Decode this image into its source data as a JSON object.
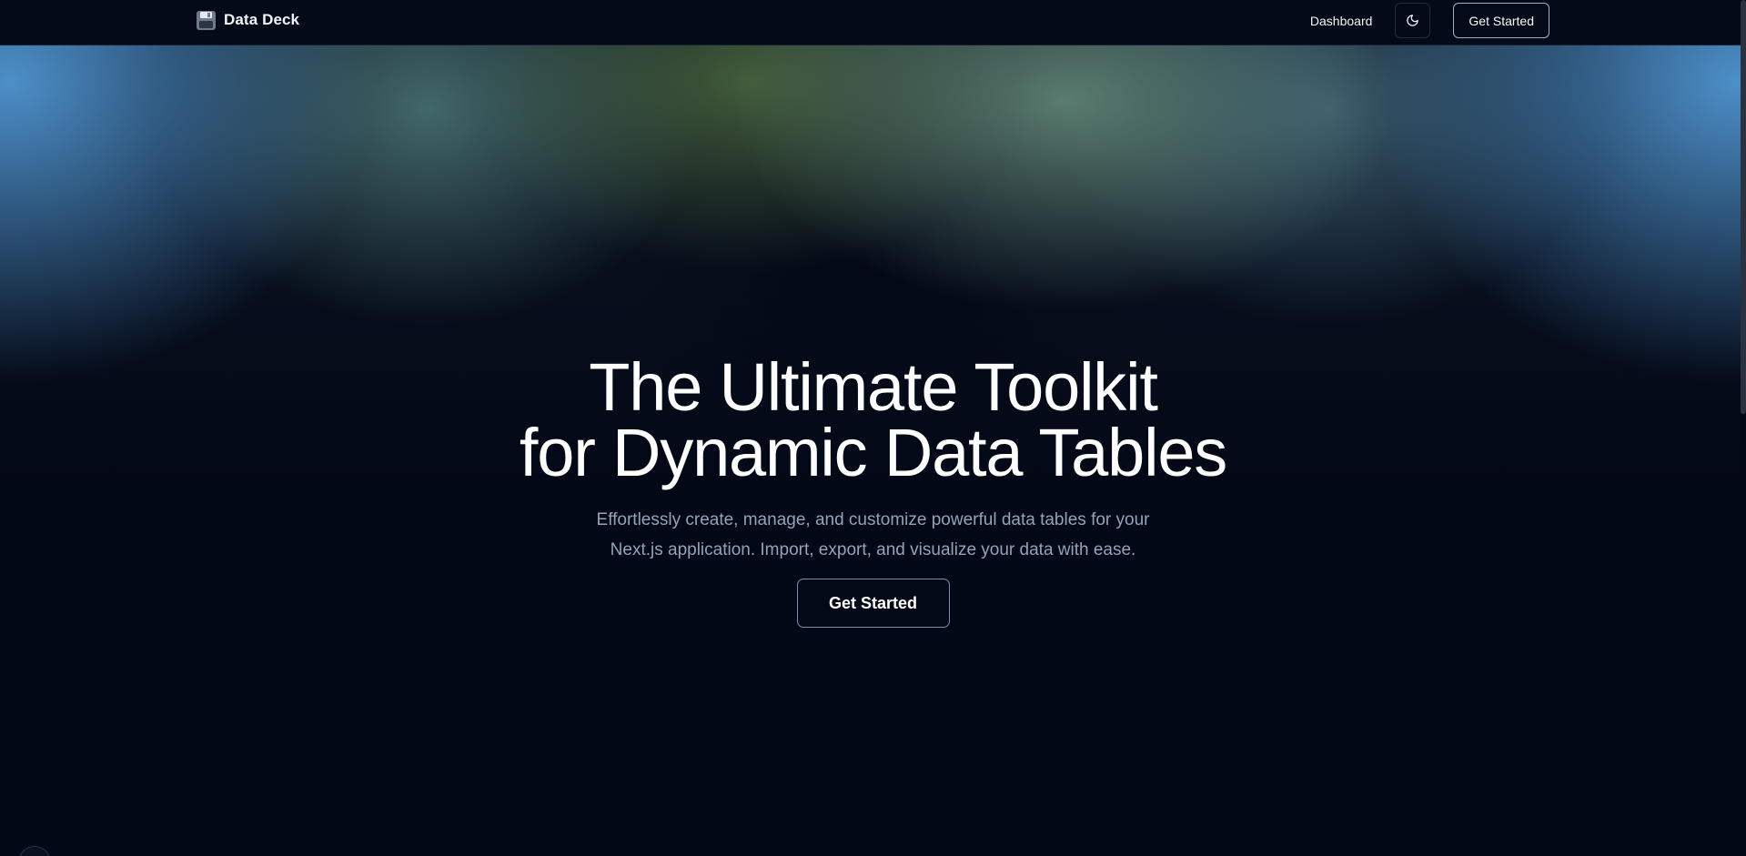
{
  "navbar": {
    "brand_name": "Data Deck",
    "brand_icon": "floppy-disk-icon",
    "links": [
      {
        "label": "Dashboard"
      }
    ],
    "theme_toggle_icon": "moon-icon",
    "cta_label": "Get Started"
  },
  "hero": {
    "title_line1": "The Ultimate Toolkit",
    "title_line2": "for Dynamic Data Tables",
    "subtitle_line1": "Effortlessly create, manage, and customize powerful data tables for your",
    "subtitle_line2": "Next.js application. Import, export, and visualize your data with ease.",
    "cta_label": "Get Started"
  },
  "colors": {
    "background": "#030816",
    "glow_blue": "#5096d2",
    "glow_green": "#6e9682",
    "text_primary": "#ffffff",
    "text_muted": "#94a3b8"
  }
}
